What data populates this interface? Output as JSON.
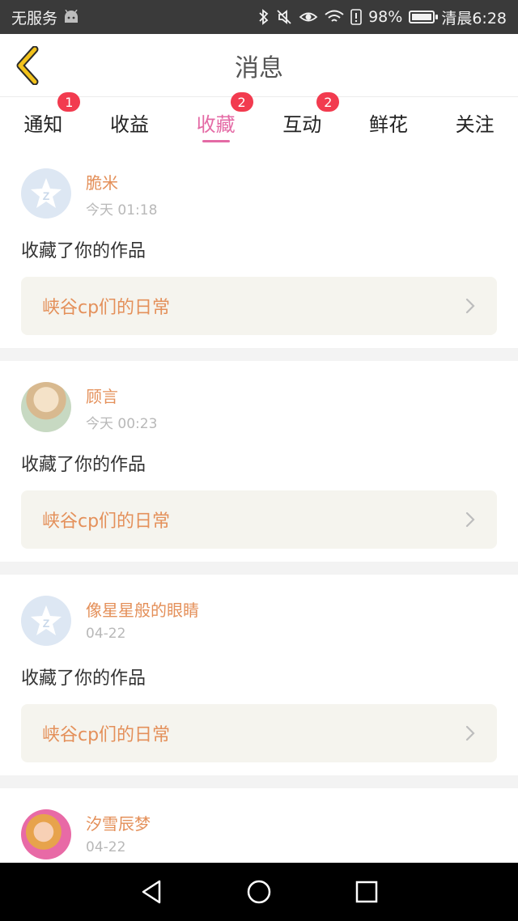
{
  "status_bar": {
    "carrier": "无服务",
    "battery_percent": "98%",
    "time": "清晨6:28",
    "battery_level": 0.98
  },
  "header": {
    "title": "消息"
  },
  "tabs": [
    {
      "label": "通知",
      "badge": "1",
      "active": false
    },
    {
      "label": "收益",
      "badge": "",
      "active": false
    },
    {
      "label": "收藏",
      "badge": "2",
      "active": true
    },
    {
      "label": "互动",
      "badge": "2",
      "active": false
    },
    {
      "label": "鲜花",
      "badge": "",
      "active": false
    },
    {
      "label": "关注",
      "badge": "",
      "active": false
    }
  ],
  "feed": [
    {
      "username": "脆米",
      "time": "今天 01:18",
      "action": "收藏了你的作品",
      "work_title": "峡谷cp们的日常",
      "avatar": "default-avatar"
    },
    {
      "username": "顾言",
      "time": "今天 00:23",
      "action": "收藏了你的作品",
      "work_title": "峡谷cp们的日常",
      "avatar": "anime-girl-avatar"
    },
    {
      "username": "像星星般的眼睛",
      "time": "04-22",
      "action": "收藏了你的作品",
      "work_title": "峡谷cp们的日常",
      "avatar": "default-avatar"
    },
    {
      "username": "汐雪辰梦",
      "time": "04-22",
      "action": "",
      "work_title": "",
      "avatar": "doll-avatar"
    }
  ],
  "colors": {
    "accent": "#e46aa5",
    "username": "#e4905a",
    "badge": "#f23b4f",
    "back_arrow": "#f2c21b"
  }
}
